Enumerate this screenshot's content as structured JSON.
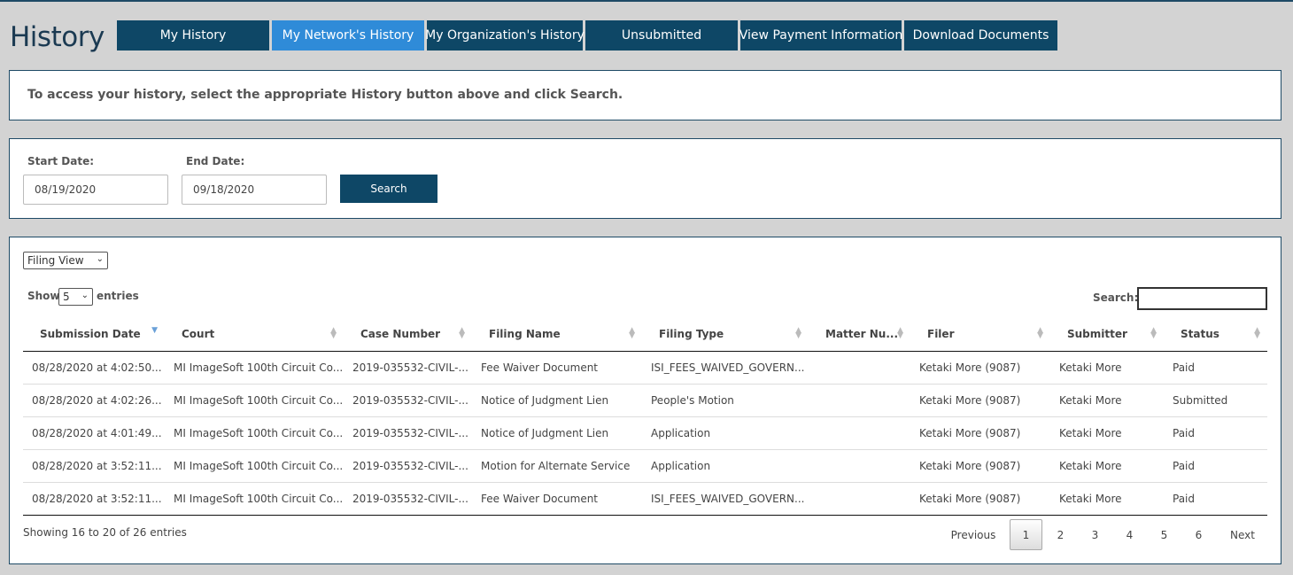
{
  "page": {
    "title": "History"
  },
  "tabs": [
    {
      "label": "My History"
    },
    {
      "label": "My Network's History"
    },
    {
      "label": "My Organization's History"
    },
    {
      "label": "Unsubmitted"
    },
    {
      "label": "View Payment Information"
    },
    {
      "label": "Download Documents"
    }
  ],
  "info": {
    "text": "To access your history, select the appropriate History button above and click Search."
  },
  "search_form": {
    "start_label": "Start Date:",
    "start_value": "08/19/2020",
    "end_label": "End Date:",
    "end_value": "09/18/2020",
    "search_button": "Search"
  },
  "results": {
    "view_select": "Filing View",
    "show_label": "Show",
    "entries_value": "5",
    "entries_label": "entries",
    "search_label": "Search:",
    "search_value": "",
    "columns": [
      "Submission Date",
      "Court",
      "Case Number",
      "Filing Name",
      "Filing Type",
      "Matter Nu...",
      "Filer",
      "Submitter",
      "Status"
    ],
    "rows": [
      [
        "08/28/2020 at 4:02:50...",
        "MI ImageSoft 100th Circuit Co...",
        "2019-035532-CIVIL-...",
        "Fee Waiver Document",
        "ISI_FEES_WAIVED_GOVERN...",
        "",
        "Ketaki More (9087)",
        "Ketaki More",
        "Paid"
      ],
      [
        "08/28/2020 at 4:02:26...",
        "MI ImageSoft 100th Circuit Co...",
        "2019-035532-CIVIL-...",
        "Notice of Judgment Lien",
        "People's Motion",
        "",
        "Ketaki More (9087)",
        "Ketaki More",
        "Submitted"
      ],
      [
        "08/28/2020 at 4:01:49...",
        "MI ImageSoft 100th Circuit Co...",
        "2019-035532-CIVIL-...",
        "Notice of Judgment Lien",
        "Application",
        "",
        "Ketaki More (9087)",
        "Ketaki More",
        "Paid"
      ],
      [
        "08/28/2020 at 3:52:11...",
        "MI ImageSoft 100th Circuit Co...",
        "2019-035532-CIVIL-...",
        "Motion for Alternate Service",
        "Application",
        "",
        "Ketaki More (9087)",
        "Ketaki More",
        "Paid"
      ],
      [
        "08/28/2020 at 3:52:11...",
        "MI ImageSoft 100th Circuit Co...",
        "2019-035532-CIVIL-...",
        "Fee Waiver Document",
        "ISI_FEES_WAIVED_GOVERN...",
        "",
        "Ketaki More (9087)",
        "Ketaki More",
        "Paid"
      ]
    ],
    "footer": "Showing 16 to 20 of 26 entries",
    "pagination": {
      "previous": "Previous",
      "pages": [
        "1",
        "2",
        "3",
        "4",
        "5",
        "6"
      ],
      "current": "1",
      "next": "Next"
    }
  }
}
